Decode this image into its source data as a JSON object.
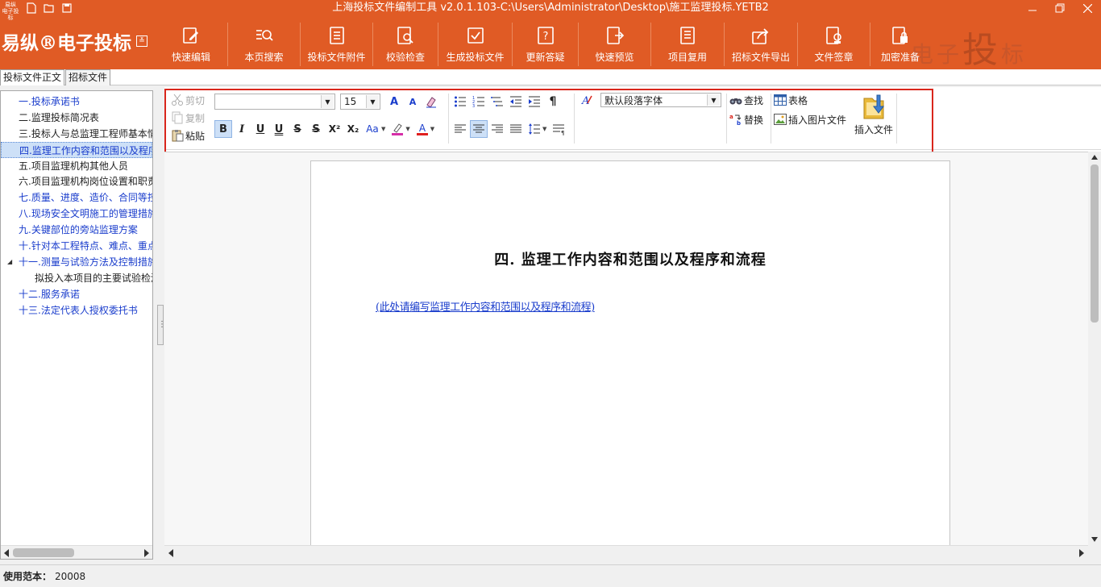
{
  "window": {
    "title": "上海投标文件编制工具 v2.0.1.103-C:\\Users\\Administrator\\Desktop\\施工监理投标.YETB2",
    "app_mini_logo": "易纵 电子投标"
  },
  "brand": {
    "name": "易纵®电子投标",
    "watermark_small1": "电子",
    "watermark_big": "投",
    "watermark_small2": "标"
  },
  "ribbon": {
    "items": [
      {
        "label": "快速编辑",
        "icon": "edit-icon"
      },
      {
        "label": "本页搜索",
        "icon": "search-list-icon"
      },
      {
        "label": "投标文件附件",
        "icon": "attachment-doc-icon"
      },
      {
        "label": "校验检查",
        "icon": "check-doc-icon"
      },
      {
        "label": "生成投标文件",
        "icon": "generate-icon"
      },
      {
        "label": "更新答疑",
        "icon": "qa-icon"
      },
      {
        "label": "快速预览",
        "icon": "preview-icon"
      },
      {
        "label": "项目复用",
        "icon": "reuse-icon"
      },
      {
        "label": "招标文件导出",
        "icon": "export-icon"
      },
      {
        "label": "文件签章",
        "icon": "seal-icon"
      },
      {
        "label": "加密准备",
        "icon": "lock-icon"
      }
    ]
  },
  "left_tabs": [
    {
      "label": "投标文件正文",
      "active": true
    },
    {
      "label": "招标文件",
      "active": false
    }
  ],
  "tree": {
    "items": [
      {
        "label": "一.投标承诺书",
        "style": "link"
      },
      {
        "label": "二.监理投标简况表",
        "style": "normal"
      },
      {
        "label": "三.投标人与总监理工程师基本情况",
        "style": "normal"
      },
      {
        "label": "四.监理工作内容和范围以及程序和流程",
        "style": "selected"
      },
      {
        "label": "五.项目监理机构其他人员",
        "style": "normal"
      },
      {
        "label": "六.项目监理机构岗位设置和职责",
        "style": "normal"
      },
      {
        "label": "七.质量、进度、造价、合同等控制",
        "style": "link"
      },
      {
        "label": "八.现场安全文明施工的管理措施",
        "style": "link"
      },
      {
        "label": "九.关键部位的旁站监理方案",
        "style": "link"
      },
      {
        "label": "十.针对本工程特点、难点、重点",
        "style": "link"
      },
      {
        "label": "十一.测量与试验方法及控制措施",
        "style": "link",
        "expand": "◢"
      },
      {
        "label": "拟投入本项目的主要试验检测设备",
        "style": "child"
      },
      {
        "label": "十二.服务承诺",
        "style": "link"
      },
      {
        "label": "十三.法定代表人授权委托书",
        "style": "link"
      }
    ]
  },
  "toolbar": {
    "cut": "剪切",
    "copy": "复制",
    "paste": "粘贴",
    "font_name": "",
    "font_size": "15",
    "bold": "B",
    "italic": "I",
    "underline": "U",
    "double_underline": "U",
    "strike": "S",
    "double_strike": "S",
    "superscript": "X²",
    "subscript": "X₂",
    "change_case": "Aa",
    "grow_font": "A",
    "shrink_font": "A",
    "pilcrow": "¶",
    "paragraph_style": "默认段落字体",
    "find": "查找",
    "replace": "替换",
    "table": "表格",
    "insert_image": "插入图片文件",
    "insert_file": "插入文件"
  },
  "document": {
    "heading": "四. 监理工作内容和范围以及程序和流程",
    "placeholder": "(此处请编写监理工作内容和范围以及程序和流程)"
  },
  "status": {
    "label": "使用范本：",
    "value": "20008"
  },
  "colors": {
    "accent": "#e05b25",
    "link": "#1a3dcc",
    "highlight": "#d9261c"
  }
}
